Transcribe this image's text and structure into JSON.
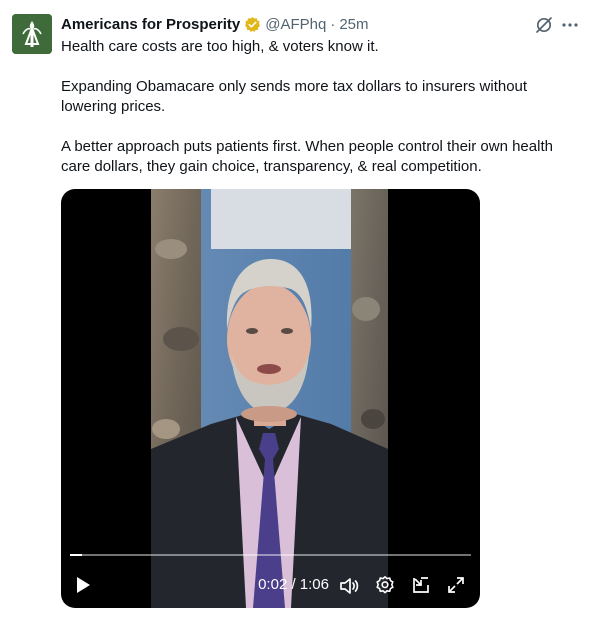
{
  "tweet": {
    "author_name": "Americans for Prosperity",
    "verified_icon": "gold-verified-badge",
    "handle": "@AFPhq",
    "separator": "·",
    "time_ago": "25m",
    "paragraphs": [
      "Health care costs are too high, & voters know it.",
      "Expanding Obamacare only sends more tax dollars to insurers without lowering prices.",
      "A better approach puts patients first. When people control their own health care dollars, they gain choice, transparency, & real competition."
    ]
  },
  "video": {
    "progress": 0.03,
    "time_label": "0:02 / 1:06",
    "icons": [
      "play-icon",
      "volume-icon",
      "settings-gear-icon",
      "picture-in-picture-icon",
      "fullscreen-icon"
    ]
  },
  "colors": {
    "text": "#0f1419",
    "secondary": "#536471",
    "verified_gold": "#e2b719",
    "avatar_green": "#3f6b3a"
  }
}
